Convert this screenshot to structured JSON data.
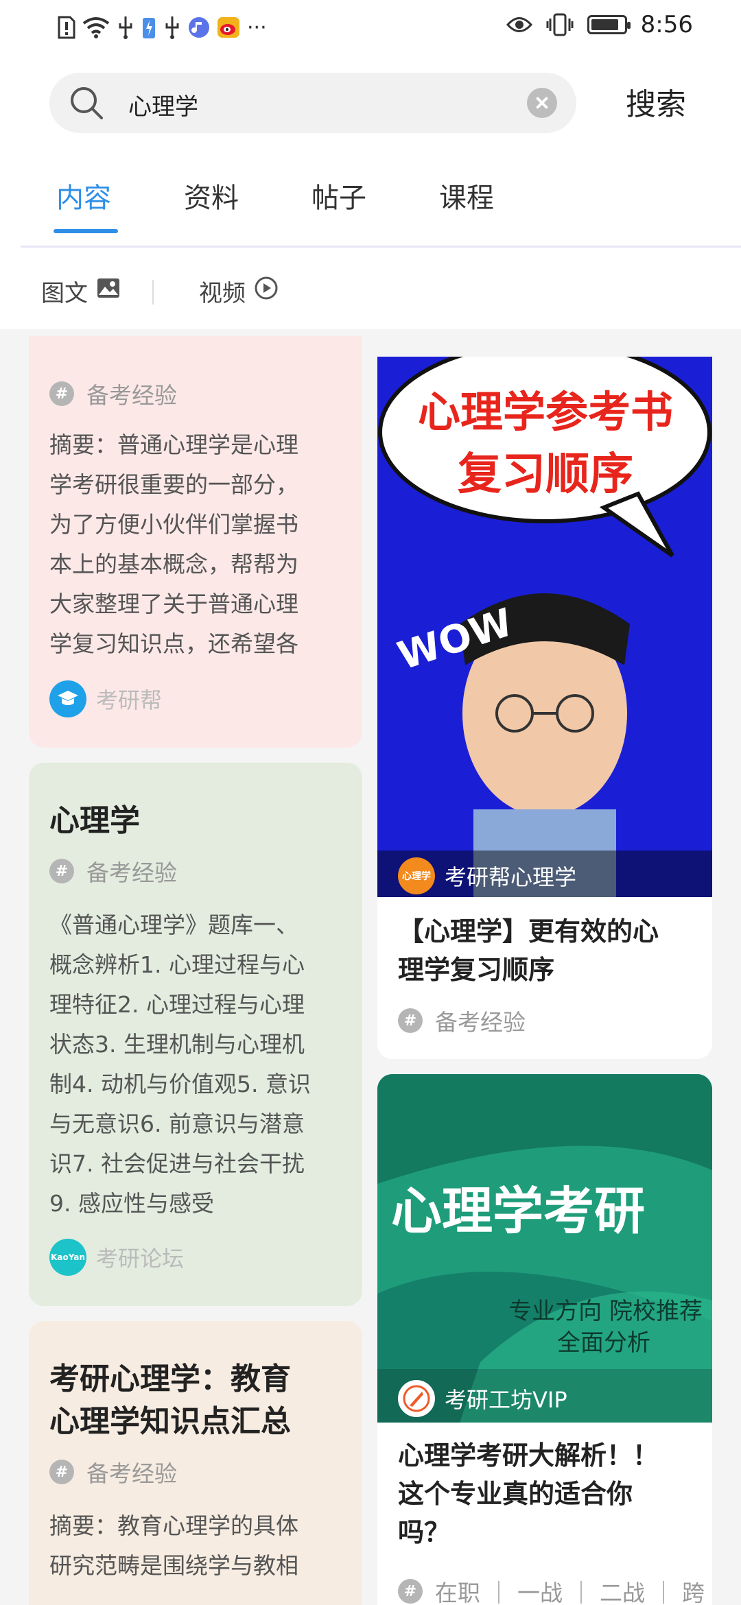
{
  "status_bar": {
    "time": "8:56",
    "more": "···",
    "battery_level": 0.85
  },
  "search": {
    "value": "心理学",
    "button_label": "搜索"
  },
  "tabs": [
    {
      "label": "内容",
      "active": true
    },
    {
      "label": "资料",
      "active": false
    },
    {
      "label": "帖子",
      "active": false
    },
    {
      "label": "课程",
      "active": false
    }
  ],
  "filters": [
    {
      "label": "图文",
      "icon": "image-icon"
    },
    {
      "label": "视频",
      "icon": "play-circle-icon"
    }
  ],
  "feed": {
    "left": [
      {
        "tag": "备考经验",
        "summary_lines": [
          "摘要：普通心理学是心理",
          "学考研很重要的一部分，",
          "为了方便小伙伴们掌握书",
          "本上的基本概念，帮帮为",
          "大家整理了关于普通心理",
          "学复习知识点，还希望各"
        ],
        "author": "考研帮",
        "bg": "#fde8e8"
      },
      {
        "title": "心理学",
        "tag": "备考经验",
        "summary_lines": [
          "《普通心理学》题库一、",
          "概念辨析1. 心理过程与心",
          "理特征2. 心理过程与心理",
          "状态3. 生理机制与心理机",
          "制4. 动机与价值观5. 意识",
          "与无意识6. 前意识与潜意",
          "识7. 社会促进与社会干扰",
          "9. 感应性与感受"
        ],
        "author": "考研论坛",
        "avatar_text": "KaoYan",
        "bg": "#e3ecdf"
      },
      {
        "title_lines": [
          "考研心理学：教育",
          "心理学知识点汇总"
        ],
        "tag": "备考经验",
        "summary_lines": [
          "摘要：教育心理学的具体",
          "研究范畴是围绕学与教相"
        ],
        "bg": "#f7ece1"
      }
    ],
    "right": [
      {
        "thumb_title_1": "心理学参考书",
        "thumb_title_2": "复习顺序",
        "thumb_wow": "WOW",
        "thumb_author": "考研帮心理学",
        "thumb_avatar_text": "心理学",
        "title_lines": [
          "【心理学】更有效的心",
          "理学复习顺序"
        ],
        "tag": "备考经验",
        "thumb_bg": "#1a1fd6"
      },
      {
        "thumb_title": "心理学考研",
        "thumb_sub_1": "专业方向 院校推荐",
        "thumb_sub_2": "全面分析",
        "thumb_author": "考研工坊VIP",
        "title_lines": [
          "心理学考研大解析！！",
          "这个专业真的适合你",
          "吗？"
        ],
        "tags_text": "在职 ｜ 一战 ｜ 二战 ｜ 跨",
        "thumb_bg": "#1f9d7b"
      }
    ]
  }
}
